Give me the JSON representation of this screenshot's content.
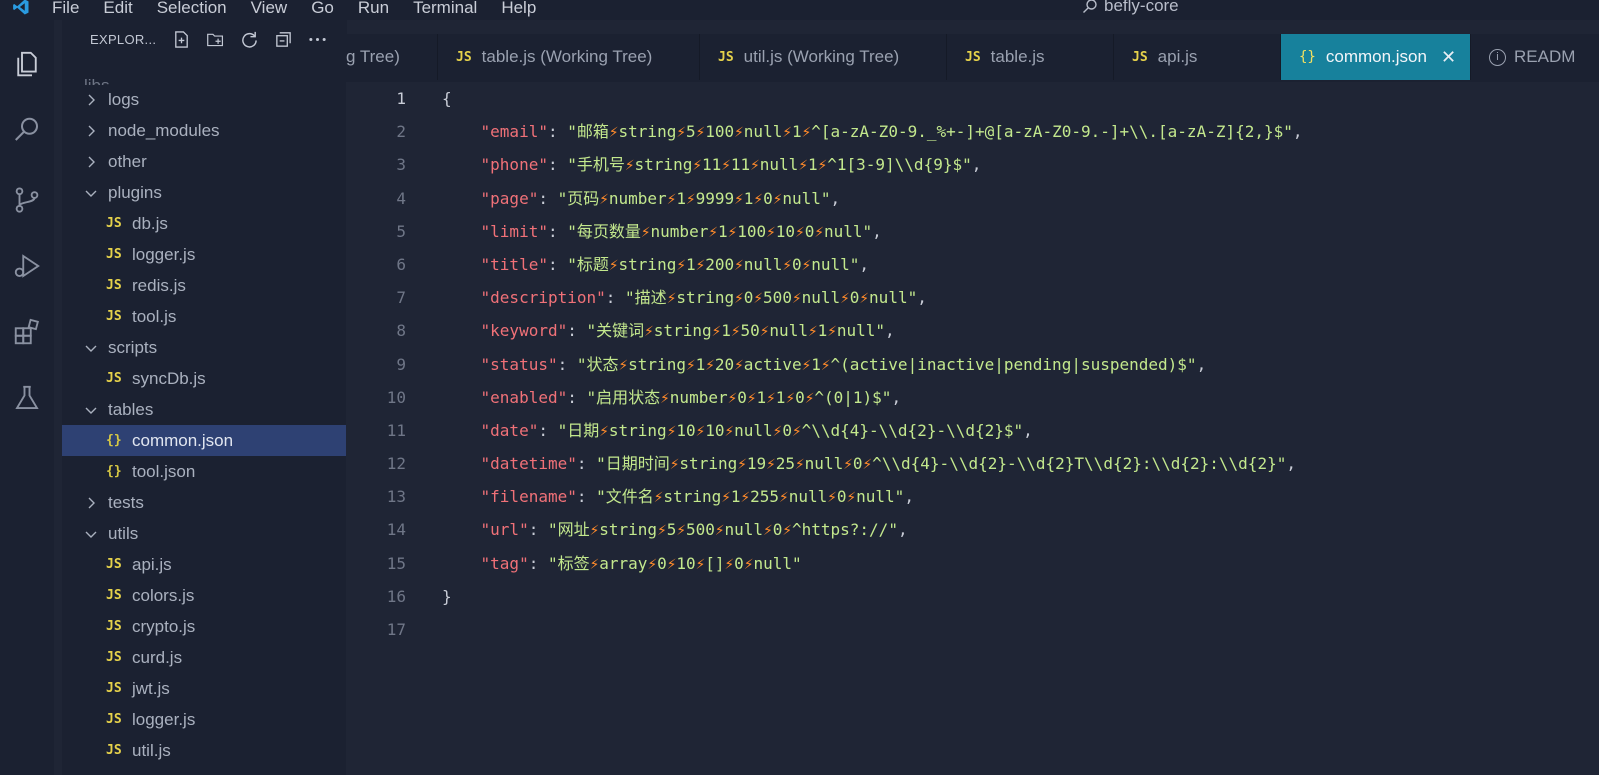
{
  "titlebar": {
    "menu": [
      "File",
      "Edit",
      "Selection",
      "View",
      "Go",
      "Run",
      "Terminal",
      "Help"
    ],
    "search_text": "befly-core"
  },
  "sidebar": {
    "title": "EXPLOR...",
    "actions": [
      "new-file-icon",
      "new-folder-icon",
      "refresh-icon",
      "collapse-all-icon",
      "more-icon"
    ],
    "ghost_item": "libs",
    "items": [
      {
        "label": "logs",
        "kind": "folder",
        "state": "collapsed"
      },
      {
        "label": "node_modules",
        "kind": "folder",
        "state": "collapsed"
      },
      {
        "label": "other",
        "kind": "folder",
        "state": "collapsed"
      },
      {
        "label": "plugins",
        "kind": "folder",
        "state": "expanded"
      },
      {
        "label": "db.js",
        "kind": "js"
      },
      {
        "label": "logger.js",
        "kind": "js"
      },
      {
        "label": "redis.js",
        "kind": "js"
      },
      {
        "label": "tool.js",
        "kind": "js"
      },
      {
        "label": "scripts",
        "kind": "folder",
        "state": "expanded"
      },
      {
        "label": "syncDb.js",
        "kind": "js"
      },
      {
        "label": "tables",
        "kind": "folder",
        "state": "expanded"
      },
      {
        "label": "common.json",
        "kind": "json",
        "selected": true
      },
      {
        "label": "tool.json",
        "kind": "json"
      },
      {
        "label": "tests",
        "kind": "folder",
        "state": "collapsed"
      },
      {
        "label": "utils",
        "kind": "folder",
        "state": "expanded"
      },
      {
        "label": "api.js",
        "kind": "js"
      },
      {
        "label": "colors.js",
        "kind": "js"
      },
      {
        "label": "crypto.js",
        "kind": "js"
      },
      {
        "label": "curd.js",
        "kind": "js"
      },
      {
        "label": "jwt.js",
        "kind": "js"
      },
      {
        "label": "logger.js",
        "kind": "js"
      },
      {
        "label": "util.js",
        "kind": "js"
      }
    ]
  },
  "tabs": [
    {
      "label": "g Tree)",
      "icon": "none"
    },
    {
      "label": "table.js (Working Tree)",
      "icon": "JS"
    },
    {
      "label": "util.js (Working Tree)",
      "icon": "JS"
    },
    {
      "label": "table.js",
      "icon": "JS"
    },
    {
      "label": "api.js",
      "icon": "JS"
    },
    {
      "label": "common.json",
      "icon": "{}",
      "active": true
    },
    {
      "label": "READM",
      "icon": "info"
    }
  ],
  "editor": {
    "current_line": 1,
    "line_numbers": [
      "1",
      "2",
      "3",
      "4",
      "5",
      "6",
      "7",
      "8",
      "9",
      "10",
      "11",
      "12",
      "13",
      "14",
      "15",
      "16",
      "17"
    ],
    "open_brace": "{",
    "close_brace": "}",
    "bolt": "⚡",
    "entries": [
      {
        "key": "\"email\"",
        "parts": [
          "邮箱",
          "string",
          "5",
          "100",
          "null",
          "1",
          "^[a-zA-Z0-9._%+-]+@[a-zA-Z0-9.-]+\\\\.[a-zA-Z]{2,}$"
        ],
        "comma": true
      },
      {
        "key": "\"phone\"",
        "parts": [
          "手机号",
          "string",
          "11",
          "11",
          "null",
          "1",
          "^1[3-9]\\\\d{9}$"
        ],
        "comma": true
      },
      {
        "key": "\"page\"",
        "parts": [
          "页码",
          "number",
          "1",
          "9999",
          "1",
          "0",
          "null"
        ],
        "comma": true
      },
      {
        "key": "\"limit\"",
        "parts": [
          "每页数量",
          "number",
          "1",
          "100",
          "10",
          "0",
          "null"
        ],
        "comma": true
      },
      {
        "key": "\"title\"",
        "parts": [
          "标题",
          "string",
          "1",
          "200",
          "null",
          "0",
          "null"
        ],
        "comma": true
      },
      {
        "key": "\"description\"",
        "parts": [
          "描述",
          "string",
          "0",
          "500",
          "null",
          "0",
          "null"
        ],
        "comma": true
      },
      {
        "key": "\"keyword\"",
        "parts": [
          "关键词",
          "string",
          "1",
          "50",
          "null",
          "1",
          "null"
        ],
        "comma": true
      },
      {
        "key": "\"status\"",
        "parts": [
          "状态",
          "string",
          "1",
          "20",
          "active",
          "1",
          "^(active|inactive|pending|suspended)$"
        ],
        "comma": true
      },
      {
        "key": "\"enabled\"",
        "parts": [
          "启用状态",
          "number",
          "0",
          "1",
          "1",
          "0",
          "^(0|1)$"
        ],
        "comma": true
      },
      {
        "key": "\"date\"",
        "parts": [
          "日期",
          "string",
          "10",
          "10",
          "null",
          "0",
          "^\\\\d{4}-\\\\d{2}-\\\\d{2}$"
        ],
        "comma": true
      },
      {
        "key": "\"datetime\"",
        "parts": [
          "日期时间",
          "string",
          "19",
          "25",
          "null",
          "0",
          "^\\\\d{4}-\\\\d{2}-\\\\d{2}T\\\\d{2}:\\\\d{2}:\\\\d{2}"
        ],
        "comma": true
      },
      {
        "key": "\"filename\"",
        "parts": [
          "文件名",
          "string",
          "1",
          "255",
          "null",
          "0",
          "null"
        ],
        "comma": true
      },
      {
        "key": "\"url\"",
        "parts": [
          "网址",
          "string",
          "5",
          "500",
          "null",
          "0",
          "^https?://"
        ],
        "comma": true
      },
      {
        "key": "\"tag\"",
        "parts": [
          "标签",
          "array",
          "0",
          "10",
          "[]",
          "0",
          "null"
        ],
        "comma": false
      }
    ]
  },
  "colors": {
    "key": "#f07178",
    "string": "#c3e88d",
    "bolt": "#ff8a2a",
    "active_tab": "#17819c",
    "selected_row": "#2e4173"
  }
}
